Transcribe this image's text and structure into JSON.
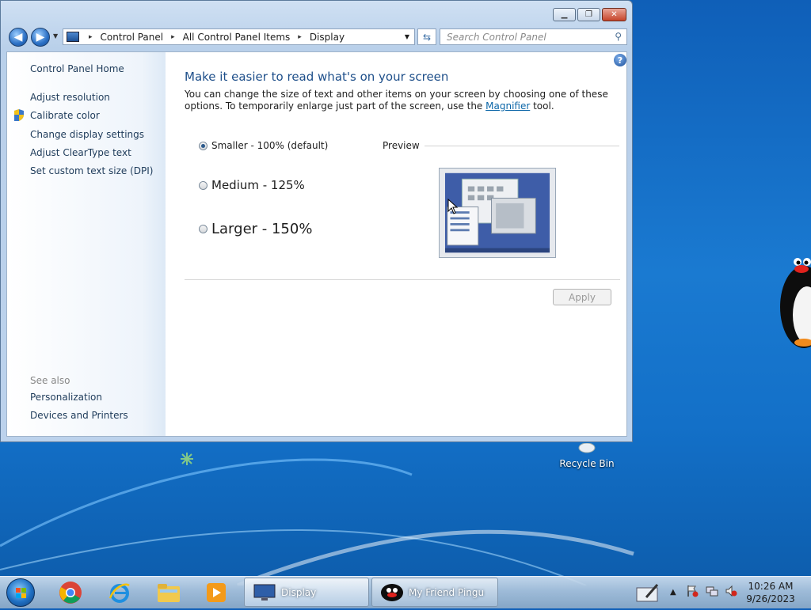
{
  "window": {
    "caption_buttons": {
      "minimize": "▁",
      "maximize": "❐",
      "close": "✕"
    },
    "address": {
      "crumbs": [
        "Control Panel",
        "All Control Panel Items",
        "Display"
      ],
      "separator": "▸"
    },
    "search_placeholder": "Search Control Panel"
  },
  "sidebar": {
    "home": "Control Panel Home",
    "links": [
      "Adjust resolution",
      "Calibrate color",
      "Change display settings",
      "Adjust ClearType text",
      "Set custom text size (DPI)"
    ],
    "see_also_label": "See also",
    "see_also": [
      "Personalization",
      "Devices and Printers"
    ]
  },
  "main": {
    "title": "Make it easier to read what's on your screen",
    "desc_before": "You can change the size of text and other items on your screen by choosing one of these options. To temporarily enlarge just part of the screen, use the ",
    "desc_link": "Magnifier",
    "desc_after": " tool.",
    "options": [
      {
        "label": "Smaller - 100% (default)",
        "selected": true
      },
      {
        "label": "Medium - 125%",
        "selected": false
      },
      {
        "label": "Larger - 150%",
        "selected": false
      }
    ],
    "preview_label": "Preview",
    "apply_label": "Apply",
    "help_glyph": "?"
  },
  "desktop": {
    "recycle_bin": "Recycle Bin"
  },
  "taskbar": {
    "tasks": [
      {
        "label": "Display",
        "active": true
      },
      {
        "label": "My Friend Pingu",
        "active": false
      }
    ],
    "clock_time": "10:26 AM",
    "clock_date": "9/26/2023",
    "tray_arrow": "▲"
  },
  "colors": {
    "accent": "#1e4f8a",
    "link": "#0b66a8",
    "taskbar": "#a9c2dc"
  }
}
